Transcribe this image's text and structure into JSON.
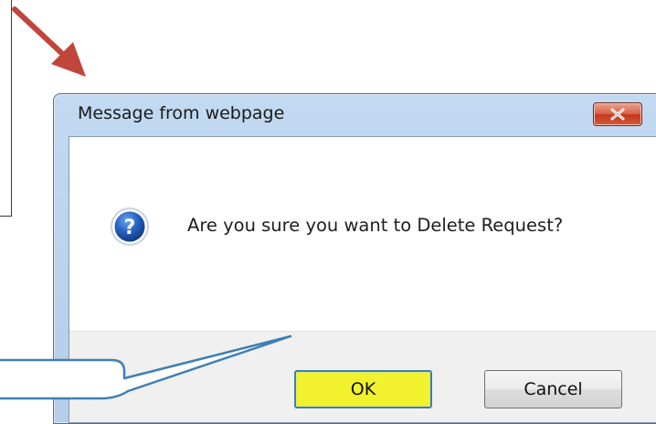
{
  "dialog": {
    "title": "Message from webpage",
    "message": "Are you sure you want to Delete Request?",
    "ok_label": "OK",
    "cancel_label": "Cancel"
  },
  "icons": {
    "close": "close-icon",
    "message": "question-icon",
    "annotation": "arrow-icon"
  },
  "colors": {
    "arrow": "#c0463c",
    "ok_highlight": "#f1f22d",
    "close_button": "#c4391e",
    "callout": "#3f7fb5",
    "frame": "#bcd4ee"
  }
}
